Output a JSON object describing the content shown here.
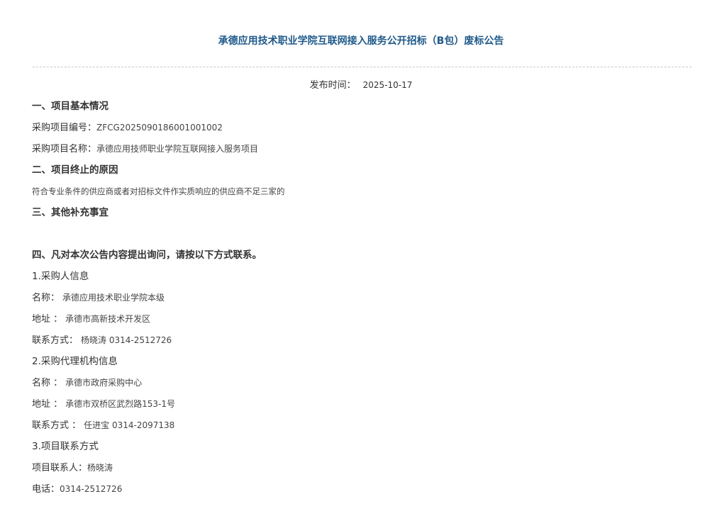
{
  "title": "承德应用技术职业学院互联网接入服务公开招标（B包）废标公告",
  "publish": {
    "label": "发布时间：",
    "date": "2025-10-17"
  },
  "section1": {
    "heading": "一、项目基本情况",
    "project_no_label": "采购项目编号：",
    "project_no": "ZFCG2025090186001001002",
    "project_name_label": "采购项目名称：",
    "project_name": "承德应用技师职业学院互联网接入服务项目"
  },
  "section2": {
    "heading": "二、项目终止的原因",
    "reason": "符合专业条件的供应商或者对招标文件作实质响应的供应商不足三家的"
  },
  "section3": {
    "heading": "三、其他补充事宜"
  },
  "section4": {
    "heading": "四、凡对本次公告内容提出询问，请按以下方式联系。",
    "purchaser": {
      "heading": "1.采购人信息",
      "name_label": "名称：",
      "name": "承德应用技术职业学院本级",
      "address_label": "地址 ：",
      "address": "承德市高新技术开发区",
      "contact_label": "联系方式：",
      "contact": "杨晓涛 0314-2512726"
    },
    "agency": {
      "heading": "2.采购代理机构信息",
      "name_label": "名称 ：",
      "name": "承德市政府采购中心",
      "address_label": "地址 ：",
      "address": "承德市双桥区武烈路153-1号",
      "contact_label": "联系方式 ：",
      "contact": "任进宝 0314-2097138"
    },
    "project_contact": {
      "heading": "3.项目联系方式",
      "person_label": "项目联系人：",
      "person": "杨晓涛",
      "phone_label": "电话：",
      "phone": "0314-2512726"
    }
  }
}
